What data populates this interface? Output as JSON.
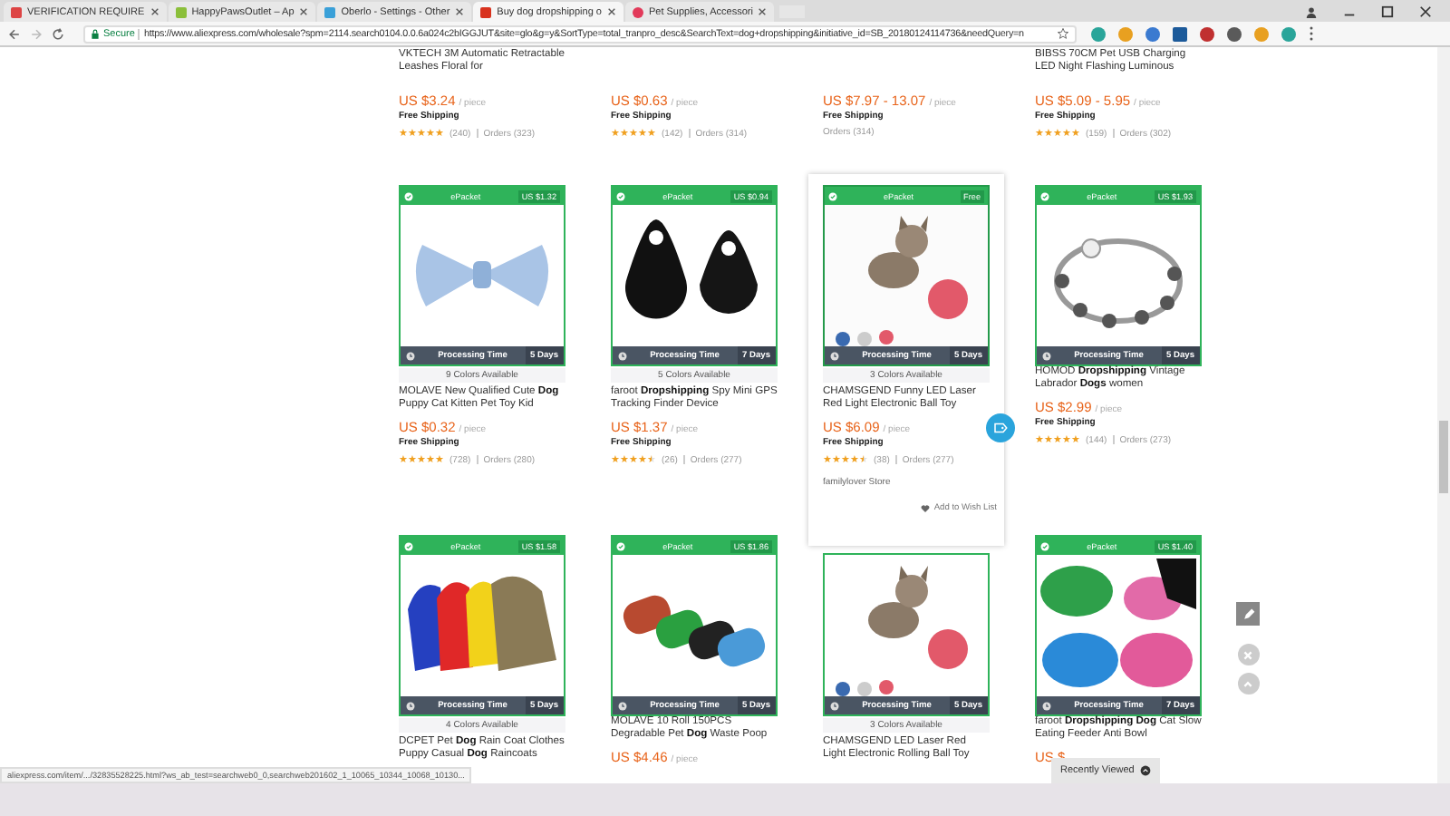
{
  "browser": {
    "tabs": [
      {
        "title": "VERIFICATION REQUIRE",
        "selected": false
      },
      {
        "title": "HappyPawsOutlet – Ap",
        "selected": false
      },
      {
        "title": "Oberlo - Settings - Other",
        "selected": false
      },
      {
        "title": "Buy dog dropshipping o",
        "selected": true
      },
      {
        "title": "Pet Supplies, Accessori",
        "selected": false
      }
    ],
    "security_label": "Secure",
    "url": "https://www.aliexpress.com/wholesale?spm=2114.search0104.0.0.6a024c2bIGGJUT&site=glo&g=y&SortType=total_tranpro_desc&SearchText=dog+dropshipping&initiative_id=SB_20180124114736&needQuery=n"
  },
  "top_row": [
    {
      "title": "VKTECH 3M Automatic Retractable Leashes Floral for",
      "price": "US $3.24",
      "unit": "/ piece",
      "shipping": "Free Shipping",
      "stars": 5,
      "reviews": "(240)",
      "orders": "Orders (323)"
    },
    {
      "price": "US $0.63",
      "unit": "/ piece",
      "shipping": "Free Shipping",
      "stars": 5,
      "reviews": "(142)",
      "orders": "Orders (314)"
    },
    {
      "price": "US $7.97 - 13.07",
      "unit": "/ piece",
      "shipping": "Free Shipping",
      "orders": "Orders (314)"
    },
    {
      "title": "BIBSS 70CM Pet USB Charging LED Night Flashing Luminous",
      "price": "US $5.09 - 5.95",
      "unit": "/ piece",
      "shipping": "Free Shipping",
      "stars": 5,
      "reviews": "(159)",
      "orders": "Orders (302)"
    }
  ],
  "product_rows": [
    [
      {
        "hovered": false,
        "method": "ePacket",
        "ship_cost": "US $1.32",
        "processing_label": "Processing Time",
        "processing_days": "5 Days",
        "colors": "9 Colors Available",
        "title": "MOLAVE New Qualified Cute **Dog** Puppy Cat Kitten Pet Toy Kid",
        "price": "US $0.32",
        "unit": "/ piece",
        "shipping": "Free Shipping",
        "stars": 5,
        "reviews": "(728)",
        "orders": "Orders (280)"
      },
      {
        "hovered": false,
        "method": "ePacket",
        "ship_cost": "US $0.94",
        "processing_label": "Processing Time",
        "processing_days": "7 Days",
        "colors": "5 Colors Available",
        "title": "faroot **Dropshipping** Spy Mini GPS Tracking Finder Device",
        "price": "US $1.37",
        "unit": "/ piece",
        "shipping": "Free Shipping",
        "stars": 4.5,
        "reviews": "(26)",
        "orders": "Orders (277)"
      },
      {
        "hovered": true,
        "method": "ePacket",
        "ship_cost": "Free",
        "processing_label": "Processing Time",
        "processing_days": "5 Days",
        "colors": "3 Colors Available",
        "title": "CHAMSGEND Funny LED Laser Red Light Electronic Ball Toy",
        "price": "US $6.09",
        "unit": "/ piece",
        "shipping": "Free Shipping",
        "stars": 4.5,
        "reviews": "(38)",
        "orders": "Orders (277)",
        "store": "familylover Store",
        "wishlist": "Add to Wish List"
      },
      {
        "hovered": false,
        "method": "ePacket",
        "ship_cost": "US $1.93",
        "processing_label": "Processing Time",
        "processing_days": "5 Days",
        "title": "HOMOD **Dropshipping** Vintage Labrador **Dogs** women",
        "price": "US $2.99",
        "unit": "/ piece",
        "shipping": "Free Shipping",
        "stars": 5,
        "reviews": "(144)",
        "orders": "Orders (273)"
      }
    ],
    [
      {
        "hovered": false,
        "method": "ePacket",
        "ship_cost": "US $1.58",
        "processing_label": "Processing Time",
        "processing_days": "5 Days",
        "colors": "4 Colors Available",
        "title": "DCPET Pet **Dog** Rain Coat Clothes Puppy Casual **Dog** Raincoats"
      },
      {
        "hovered": false,
        "method": "ePacket",
        "ship_cost": "US $1.86",
        "processing_label": "Processing Time",
        "processing_days": "5 Days",
        "title": "MOLAVE 10 Roll 150PCS Degradable Pet **Dog** Waste Poop",
        "price": "US $4.46",
        "unit": "/ piece"
      },
      {
        "hovered": false,
        "processing_label": "Processing Time",
        "processing_days": "5 Days",
        "colors": "3 Colors Available",
        "title": "CHAMSGEND LED Laser Red Light Electronic Rolling Ball Toy"
      },
      {
        "hovered": false,
        "method": "ePacket",
        "ship_cost": "US $1.40",
        "processing_label": "Processing Time",
        "processing_days": "7 Days",
        "title": "faroot **Dropshipping Dog** Cat Slow Eating Feeder Anti Bowl",
        "price": "US $"
      }
    ]
  ],
  "status_url": "aliexpress.com/item/.../32835528225.html?ws_ab_test=searchweb0_0,searchweb201602_1_10065_10344_10068_10130...",
  "recently_viewed": "Recently Viewed"
}
